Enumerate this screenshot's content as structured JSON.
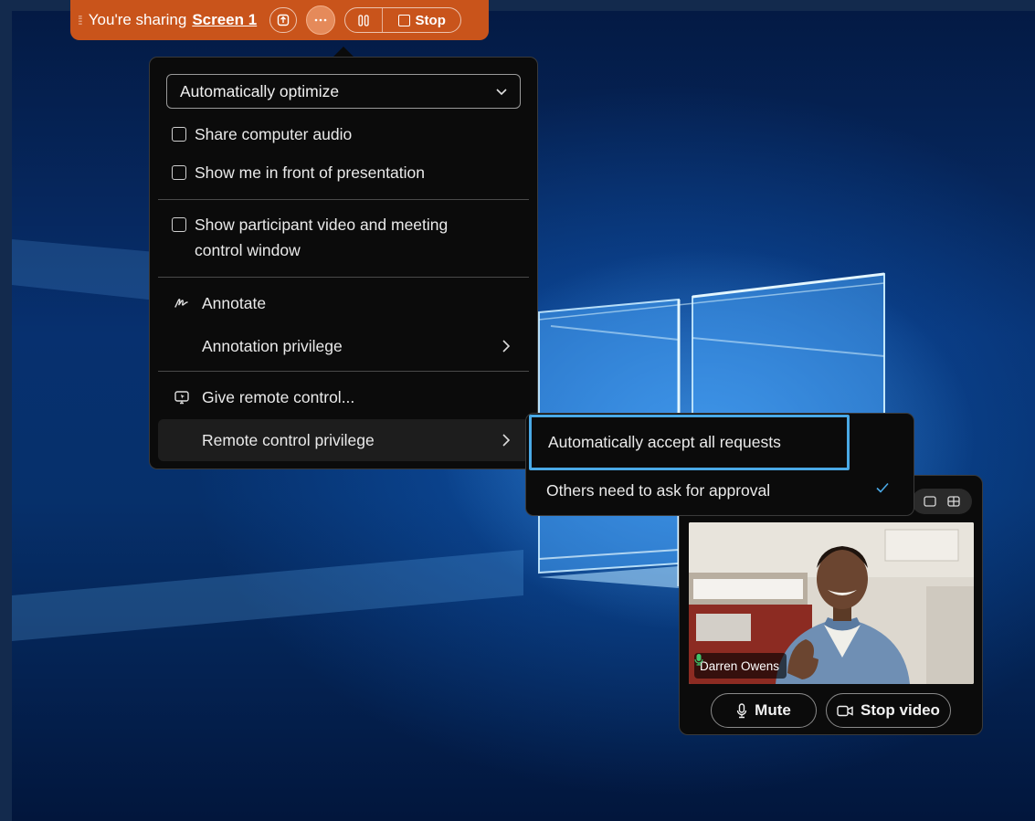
{
  "share_bar": {
    "sharing_text": "You're sharing",
    "screen_name": "Screen 1",
    "stop_label": "Stop",
    "color": "#c9541b"
  },
  "menu": {
    "optimize_value": "Automatically optimize",
    "share_audio_label": "Share computer audio",
    "show_me_label": "Show me in front of presentation",
    "show_participant_line1": "Show participant video and meeting",
    "show_participant_line2": "control window",
    "annotate_label": "Annotate",
    "annotation_privilege_label": "Annotation privilege",
    "give_remote_label": "Give remote control...",
    "remote_privilege_label": "Remote control privilege"
  },
  "submenu": {
    "auto_accept_label": "Automatically accept all requests",
    "ask_approval_label": "Others need to ask for approval",
    "selected": "Others need to ask for approval",
    "highlight_color": "#4aa9e6"
  },
  "video": {
    "participant_name": "Darren Owens",
    "mute_label": "Mute",
    "stop_video_label": "Stop video"
  }
}
